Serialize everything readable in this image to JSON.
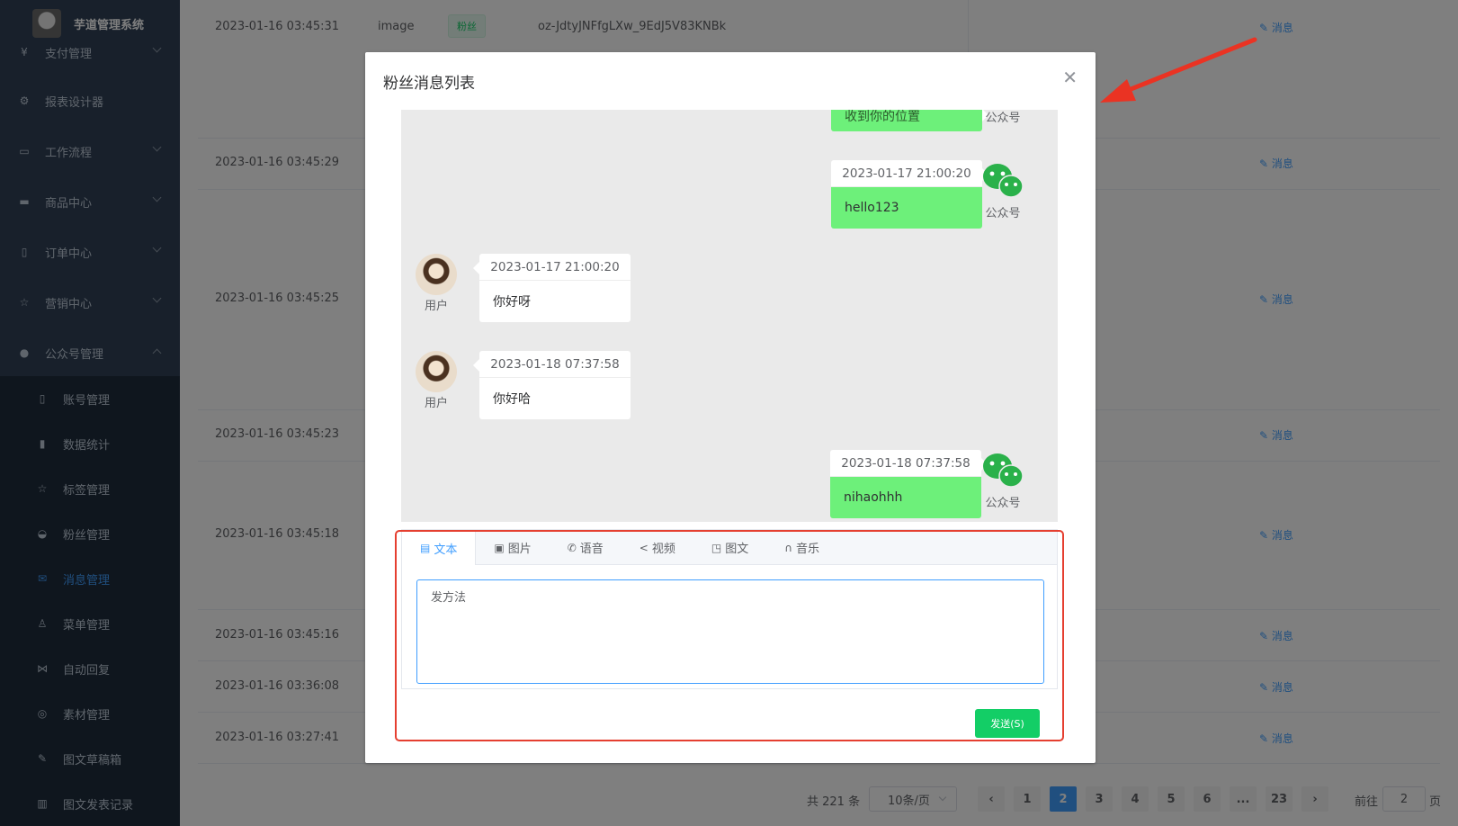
{
  "sidebar": {
    "title": "芋道管理系统",
    "items": [
      {
        "label": "支付管理",
        "icon": "pay-icon"
      },
      {
        "label": "报表设计器",
        "icon": "report-icon"
      },
      {
        "label": "工作流程",
        "icon": "workflow-icon"
      },
      {
        "label": "商品中心",
        "icon": "product-icon"
      },
      {
        "label": "订单中心",
        "icon": "order-icon"
      },
      {
        "label": "营销中心",
        "icon": "star-icon"
      },
      {
        "label": "公众号管理",
        "icon": "wechat-icon"
      }
    ],
    "subitems": [
      {
        "label": "账号管理",
        "icon": "phone-icon"
      },
      {
        "label": "数据统计",
        "icon": "chart-icon"
      },
      {
        "label": "标签管理",
        "icon": "star-icon"
      },
      {
        "label": "粉丝管理",
        "icon": "fans-icon"
      },
      {
        "label": "消息管理",
        "icon": "message-icon"
      },
      {
        "label": "菜单管理",
        "icon": "menu-icon"
      },
      {
        "label": "自动回复",
        "icon": "reply-icon"
      },
      {
        "label": "素材管理",
        "icon": "material-icon"
      },
      {
        "label": "图文草稿箱",
        "icon": "edit-icon"
      },
      {
        "label": "图文发表记录",
        "icon": "book-icon"
      }
    ]
  },
  "table": {
    "first_row": {
      "type": "image",
      "tag": "粉丝",
      "openid": "oz-JdtyJNFfgLXw_9EdJ5V83KNBk"
    },
    "action_label": "消息",
    "times": [
      "2023-01-16 03:45:31",
      "2023-01-16 03:45:29",
      "2023-01-16 03:45:25",
      "2023-01-16 03:45:23",
      "2023-01-16 03:45:18",
      "2023-01-16 03:45:16",
      "2023-01-16 03:36:08",
      "2023-01-16 03:27:41"
    ]
  },
  "pagination": {
    "total": "共 221 条",
    "page_size": "10条/页",
    "pages": [
      "1",
      "2",
      "3",
      "4",
      "5",
      "6",
      "...",
      "23"
    ],
    "current": "2",
    "goto_label": "前往",
    "goto_value": "2",
    "unit": "页"
  },
  "dialog": {
    "title": "粉丝消息列表",
    "partial_message": "收到你的位置",
    "account_label": "公众号",
    "user_label": "用户",
    "messages": [
      {
        "sender": "mp",
        "time": "2023-01-17 21:00:20",
        "text": "hello123"
      },
      {
        "sender": "user",
        "time": "2023-01-17 21:00:20",
        "text": "你好呀"
      },
      {
        "sender": "user",
        "time": "2023-01-18 07:37:58",
        "text": "你好哈"
      },
      {
        "sender": "mp",
        "time": "2023-01-18 07:37:58",
        "text": "nihaohhh"
      }
    ],
    "tabs": [
      "文本",
      "图片",
      "语音",
      "视频",
      "图文",
      "音乐"
    ],
    "active_tab": "文本",
    "input_value": "发方法",
    "send_label": "发送(S)"
  },
  "colors": {
    "primary": "#409eff",
    "sidebar_bg": "#304156",
    "bubble_green": "#6df07a",
    "send_green": "#13ce66",
    "highlight_red": "#e53f30"
  }
}
